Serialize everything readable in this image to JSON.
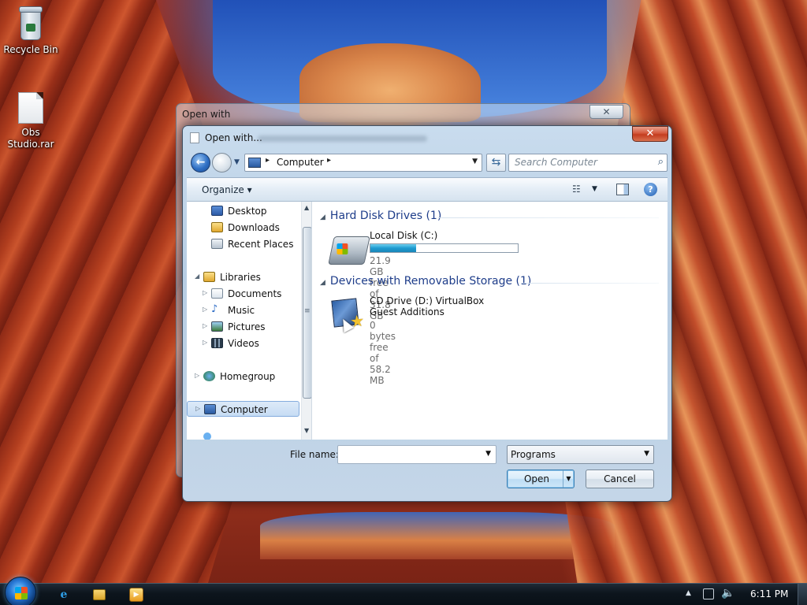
{
  "desktop": {
    "icons": [
      {
        "label": "Recycle Bin"
      },
      {
        "label": "Obs Studio.rar"
      }
    ]
  },
  "background_window": {
    "title": "Open with",
    "close_label": "✕"
  },
  "dialog": {
    "title": "Open with...",
    "close_label": "✕",
    "address": {
      "crumb": "Computer",
      "sep": "▸"
    },
    "search_placeholder": "Search Computer",
    "command_bar": {
      "organize": "Organize ▾"
    },
    "nav_pane": {
      "items": [
        {
          "label": "Desktop"
        },
        {
          "label": "Downloads"
        },
        {
          "label": "Recent Places"
        },
        {
          "label": "Libraries"
        },
        {
          "label": "Documents"
        },
        {
          "label": "Music"
        },
        {
          "label": "Pictures"
        },
        {
          "label": "Videos"
        },
        {
          "label": "Homegroup"
        },
        {
          "label": "Computer"
        }
      ]
    },
    "content": {
      "groups": [
        {
          "header": "Hard Disk Drives (1)",
          "drives": [
            {
              "name": "Local Disk (C:)",
              "free": "21.9 GB free of 31.8 GB",
              "used_fraction": 0.31
            }
          ]
        },
        {
          "header": "Devices with Removable Storage (1)",
          "drives": [
            {
              "name": "CD Drive (D:) VirtualBox Guest Additions",
              "free": "0 bytes free of 58.2 MB"
            }
          ]
        }
      ]
    },
    "file_name_label": "File name:",
    "file_name_value": "",
    "file_type_value": "Programs",
    "open_label": "Open",
    "cancel_label": "Cancel"
  },
  "taskbar": {
    "clock": "6:11 PM"
  },
  "colors": {
    "group_header": "#1e3d8a",
    "capacity_fill": "#1e9bd0",
    "close_button": "#c43c1e"
  }
}
